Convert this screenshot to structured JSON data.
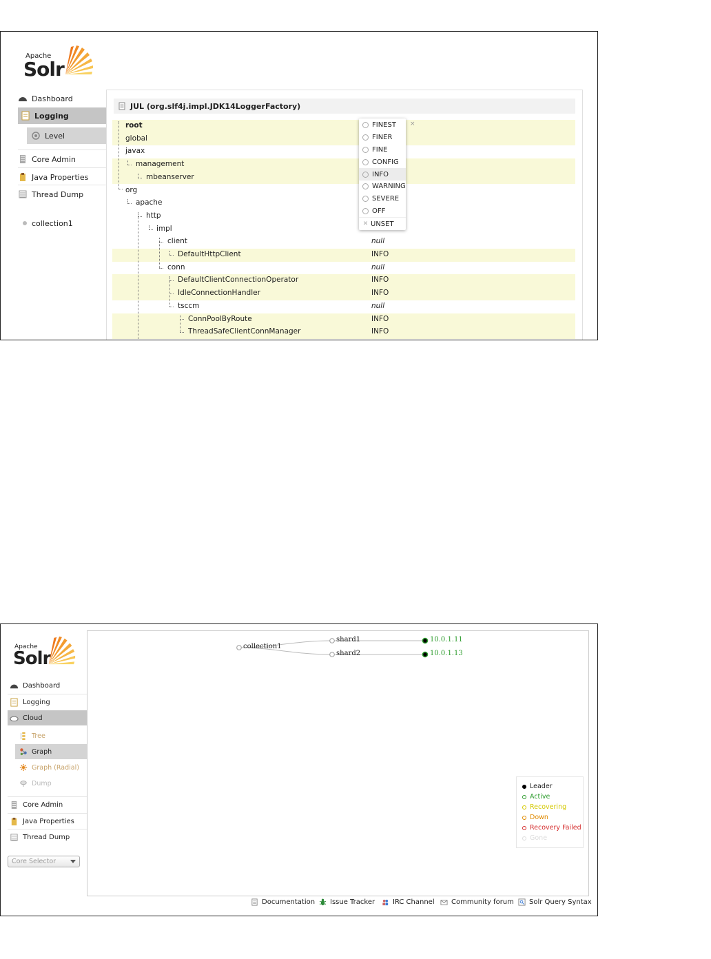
{
  "logo": {
    "apache": "Apache",
    "solr": "Solr"
  },
  "shot1": {
    "nav": [
      {
        "label": "Dashboard",
        "icon": "dashboard-icon"
      },
      {
        "label": "Logging",
        "icon": "logging-icon"
      },
      {
        "label": "Level",
        "icon": "level-icon"
      },
      {
        "label": "Core Admin",
        "icon": "core-admin-icon"
      },
      {
        "label": "Java Properties",
        "icon": "java-properties-icon"
      },
      {
        "label": "Thread Dump",
        "icon": "thread-dump-icon"
      },
      {
        "label": "collection1",
        "icon": "core-dot-icon"
      }
    ],
    "header": "JUL (org.slf4j.impl.JDK14LoggerFactory)",
    "rows": [
      {
        "name": "root",
        "level": ""
      },
      {
        "name": "global",
        "level": ""
      },
      {
        "name": "javax",
        "level": ""
      },
      {
        "name": "management",
        "level": ""
      },
      {
        "name": "mbeanserver",
        "level": ""
      },
      {
        "name": "org",
        "level": ""
      },
      {
        "name": "apache",
        "level": ""
      },
      {
        "name": "http",
        "level": ""
      },
      {
        "name": "impl",
        "level": ""
      },
      {
        "name": "client",
        "level": "null"
      },
      {
        "name": "DefaultHttpClient",
        "level": "INFO"
      },
      {
        "name": "conn",
        "level": "null"
      },
      {
        "name": "DefaultClientConnectionOperator",
        "level": "INFO"
      },
      {
        "name": "IdleConnectionHandler",
        "level": "INFO"
      },
      {
        "name": "tsccm",
        "level": "null"
      },
      {
        "name": "ConnPoolByRoute",
        "level": "INFO"
      },
      {
        "name": "ThreadSafeClientConnManager",
        "level": "INFO"
      }
    ],
    "levels": [
      "FINEST",
      "FINER",
      "FINE",
      "CONFIG",
      "INFO",
      "WARNING",
      "SEVERE",
      "OFF",
      "UNSET"
    ],
    "selected_level": "INFO",
    "close_symbol": "×"
  },
  "shot2": {
    "nav": [
      {
        "label": "Dashboard"
      },
      {
        "label": "Logging"
      },
      {
        "label": "Cloud"
      },
      {
        "label": "Tree"
      },
      {
        "label": "Graph"
      },
      {
        "label": "Graph (Radial)"
      },
      {
        "label": "Dump"
      },
      {
        "label": "Core Admin"
      },
      {
        "label": "Java Properties"
      },
      {
        "label": "Thread Dump"
      }
    ],
    "core_selector": "Core Selector",
    "graph": {
      "collection": "collection1",
      "shards": [
        "shard1",
        "shard2"
      ],
      "nodes": [
        "10.0.1.11",
        "10.0.1.13"
      ]
    },
    "legend": [
      {
        "label": "Leader",
        "color": "#000000"
      },
      {
        "label": "Active",
        "color": "#2b9b2b"
      },
      {
        "label": "Recovering",
        "color": "#d4c900"
      },
      {
        "label": "Down",
        "color": "#e08a00"
      },
      {
        "label": "Recovery Failed",
        "color": "#d42b2b"
      },
      {
        "label": "Gone",
        "color": "#dddddd"
      }
    ],
    "footer": [
      "Documentation",
      "Issue Tracker",
      "IRC Channel",
      "Community forum",
      "Solr Query Syntax"
    ]
  }
}
